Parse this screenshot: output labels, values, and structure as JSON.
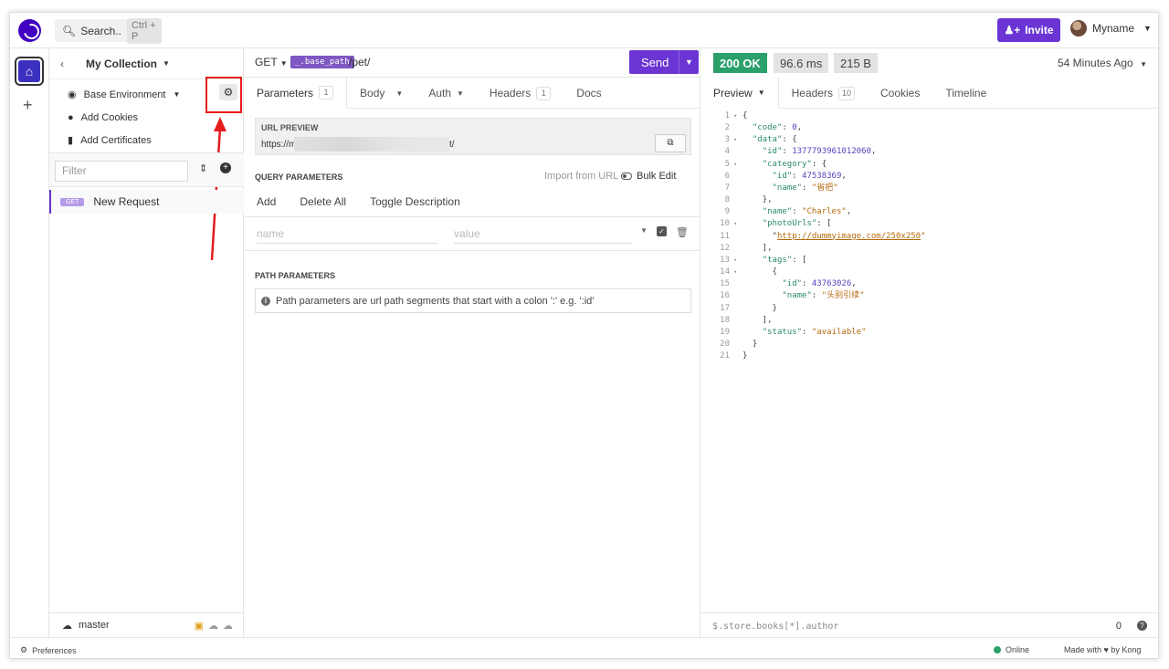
{
  "topbar": {
    "search_label": "Search..",
    "search_shortcut": "Ctrl + P",
    "invite_label": "Invite",
    "user_name": "Myname"
  },
  "sidebar": {
    "collection_title": "My Collection",
    "items": [
      {
        "label": "Base Environment"
      },
      {
        "label": "Add Cookies"
      },
      {
        "label": "Add Certificates"
      }
    ],
    "filter_placeholder": "Filter",
    "request": {
      "method": "GET",
      "name": "New Request"
    },
    "branch": "master"
  },
  "request": {
    "method": "GET",
    "base_path_tag": "_.base_path",
    "path": "/pet/",
    "send_label": "Send",
    "tabs": [
      {
        "label": "Parameters",
        "count": "1"
      },
      {
        "label": "Body"
      },
      {
        "label": "Auth"
      },
      {
        "label": "Headers",
        "count": "1"
      },
      {
        "label": "Docs"
      }
    ],
    "url_preview_label": "URL PREVIEW",
    "url_preview_start": "https://m",
    "url_preview_end": "t/",
    "query_title": "QUERY PARAMETERS",
    "import_from_url": "Import from URL",
    "bulk_edit": "Bulk Edit",
    "query_actions": [
      "Add",
      "Delete All",
      "Toggle Description"
    ],
    "name_placeholder": "name",
    "value_placeholder": "value",
    "path_title": "PATH PARAMETERS",
    "path_info": "Path parameters are url path segments that start with a colon ':' e.g. ':id'"
  },
  "response": {
    "status": "200 OK",
    "time": "96.6 ms",
    "size": "215 B",
    "ago": "54 Minutes Ago",
    "tabs": [
      {
        "label": "Preview"
      },
      {
        "label": "Headers",
        "count": "10"
      },
      {
        "label": "Cookies"
      },
      {
        "label": "Timeline"
      }
    ],
    "filter_placeholder": "$.store.books[*].author",
    "filter_count": "0"
  },
  "statusbar": {
    "preferences": "Preferences",
    "online": "Online",
    "made_with": "Made with ♥ by Kong"
  },
  "colors": {
    "accent": "#6b35d4",
    "ok": "#2ba06a",
    "annotation": "#e51c1c"
  }
}
